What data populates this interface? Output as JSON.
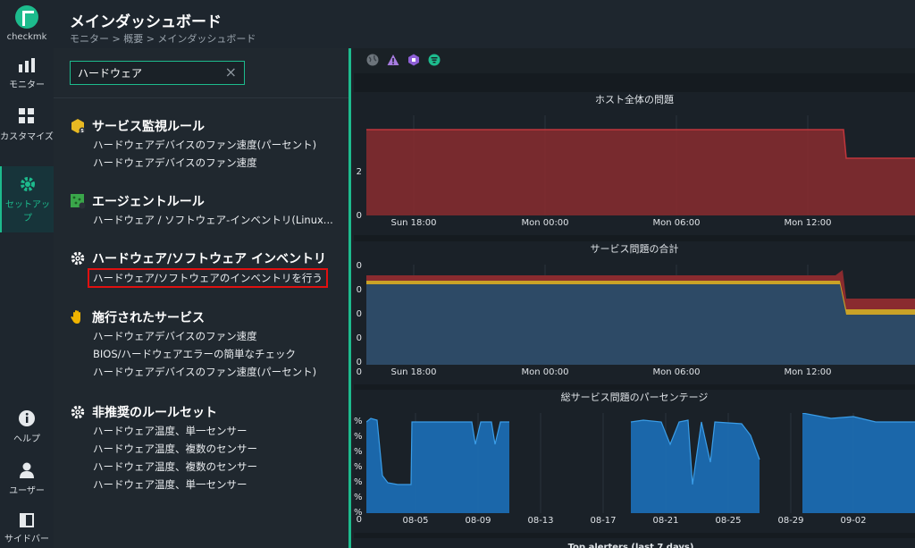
{
  "rail": {
    "brand": "checkmk",
    "monitor": "モニター",
    "customize": "カスタマイズ",
    "setup_line1": "セットアッ",
    "setup_line2": "プ",
    "help": "ヘルプ",
    "user": "ユーザー",
    "sidebar": "サイドバー"
  },
  "header": {
    "title": "メインダッシュボード",
    "breadcrumb": "モニター > 概要 > メインダッシュボード"
  },
  "search": {
    "value": "ハードウェア",
    "clear_icon": "×"
  },
  "groups": [
    {
      "title": "サービス監視ルール",
      "icon": "service-rules-icon",
      "items": [
        "ハードウェアデバイスのファン速度(パーセント)",
        "ハードウェアデバイスのファン速度"
      ]
    },
    {
      "title": "エージェントルール",
      "icon": "agent-rules-icon",
      "items": [
        "ハードウェア / ソフトウェア-インベントリ(Linux..."
      ]
    },
    {
      "title": "ハードウェア/ソフトウェア インベントリ",
      "icon": "gear-icon",
      "items": [
        "ハードウェア/ソフトウェアのインベントリを行う"
      ]
    },
    {
      "title": "施行されたサービス",
      "icon": "hand-icon",
      "items": [
        "ハードウェアデバイスのファン速度",
        "BIOS/ハードウェアエラーの簡単なチェック",
        "ハードウェアデバイスのファン速度(パーセント)"
      ]
    },
    {
      "title": "非推奨のルールセット",
      "icon": "gear-icon",
      "items": [
        "ハードウェア温度、単一センサー",
        "ハードウェア温度、複数のセンサー",
        "ハードウェア温度、複数のセンサー",
        "ハードウェア温度、単一センサー"
      ]
    }
  ],
  "chart_data": [
    {
      "type": "area",
      "title": "ホスト全体の問題",
      "x_ticks": [
        "Sun 18:00",
        "Mon 00:00",
        "Mon 06:00",
        "Mon 12:00"
      ],
      "y_ticks": [
        "2",
        "0"
      ],
      "x": [
        "Sun 14:00",
        "Mon 13:10",
        "Mon 13:12",
        "Mon 16:00"
      ],
      "values": [
        3,
        3,
        2,
        2
      ],
      "color": "#8a2b2f"
    },
    {
      "type": "area",
      "title": "サービス問題の合計",
      "x_ticks": [
        "Sun 18:00",
        "Mon 00:00",
        "Mon 06:00",
        "Mon 12:00"
      ],
      "y_ticks": [
        "0",
        "0",
        "0",
        "0",
        "0",
        "0"
      ],
      "series": [
        {
          "color": "#2d4a66"
        },
        {
          "color": "#c9a227"
        },
        {
          "color": "#8a2b2f"
        }
      ]
    },
    {
      "type": "area",
      "title": "総サービス問題のパーセンテージ",
      "x_ticks": [
        "08-05",
        "08-09",
        "08-13",
        "08-17",
        "08-21",
        "08-25",
        "08-29",
        "09-02"
      ],
      "y_ticks": [
        "%",
        "%",
        "%",
        "%",
        "%",
        "%",
        "%",
        "0"
      ],
      "color": "#1c6fb8"
    }
  ],
  "panel4_title": "Top alerters (last 7 days)"
}
